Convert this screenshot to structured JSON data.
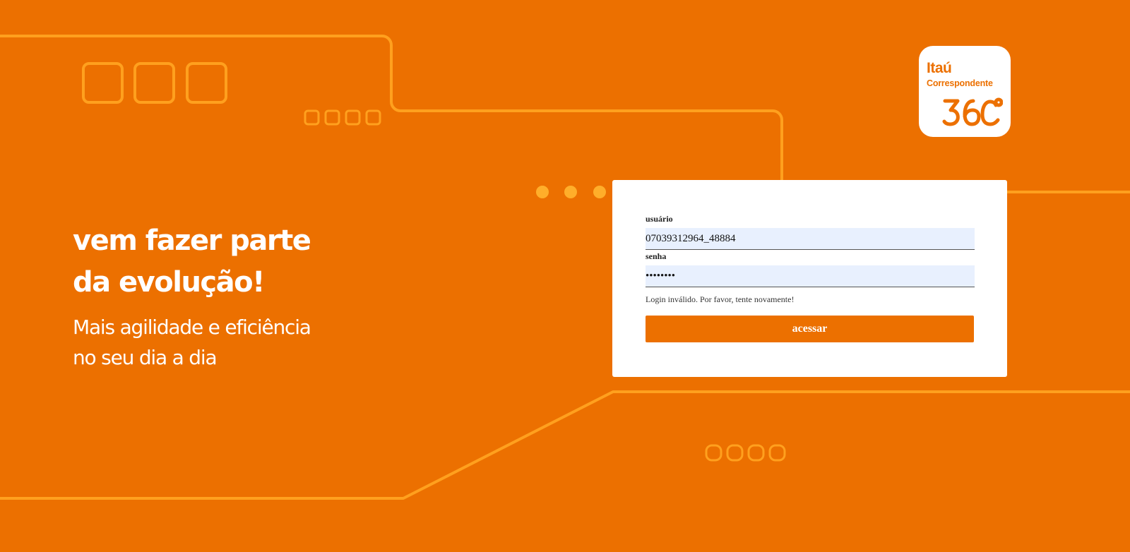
{
  "colors": {
    "background": "#EC7000",
    "line_accent": "#FFA01E",
    "dot_accent": "#FFAE2A",
    "card": "#FFFFFF",
    "input_fill": "#E8F0FE",
    "button": "#EC7000"
  },
  "hero": {
    "headline_line1": "vem fazer parte",
    "headline_line2": "da evolução!",
    "sub_line1": "Mais agilidade e eficiência",
    "sub_line2": "no seu dia a dia"
  },
  "logo": {
    "brand": "Itaú",
    "product": "Correspondente",
    "number": "360",
    "icon": "itau-correspondente-360-logo"
  },
  "login": {
    "username_label": "usuário",
    "username_value": "07039312964_48884",
    "password_label": "senha",
    "password_value": "Senha123",
    "error_message": "Login inválido. Por favor, tente novamente!",
    "submit_label": "acessar"
  }
}
